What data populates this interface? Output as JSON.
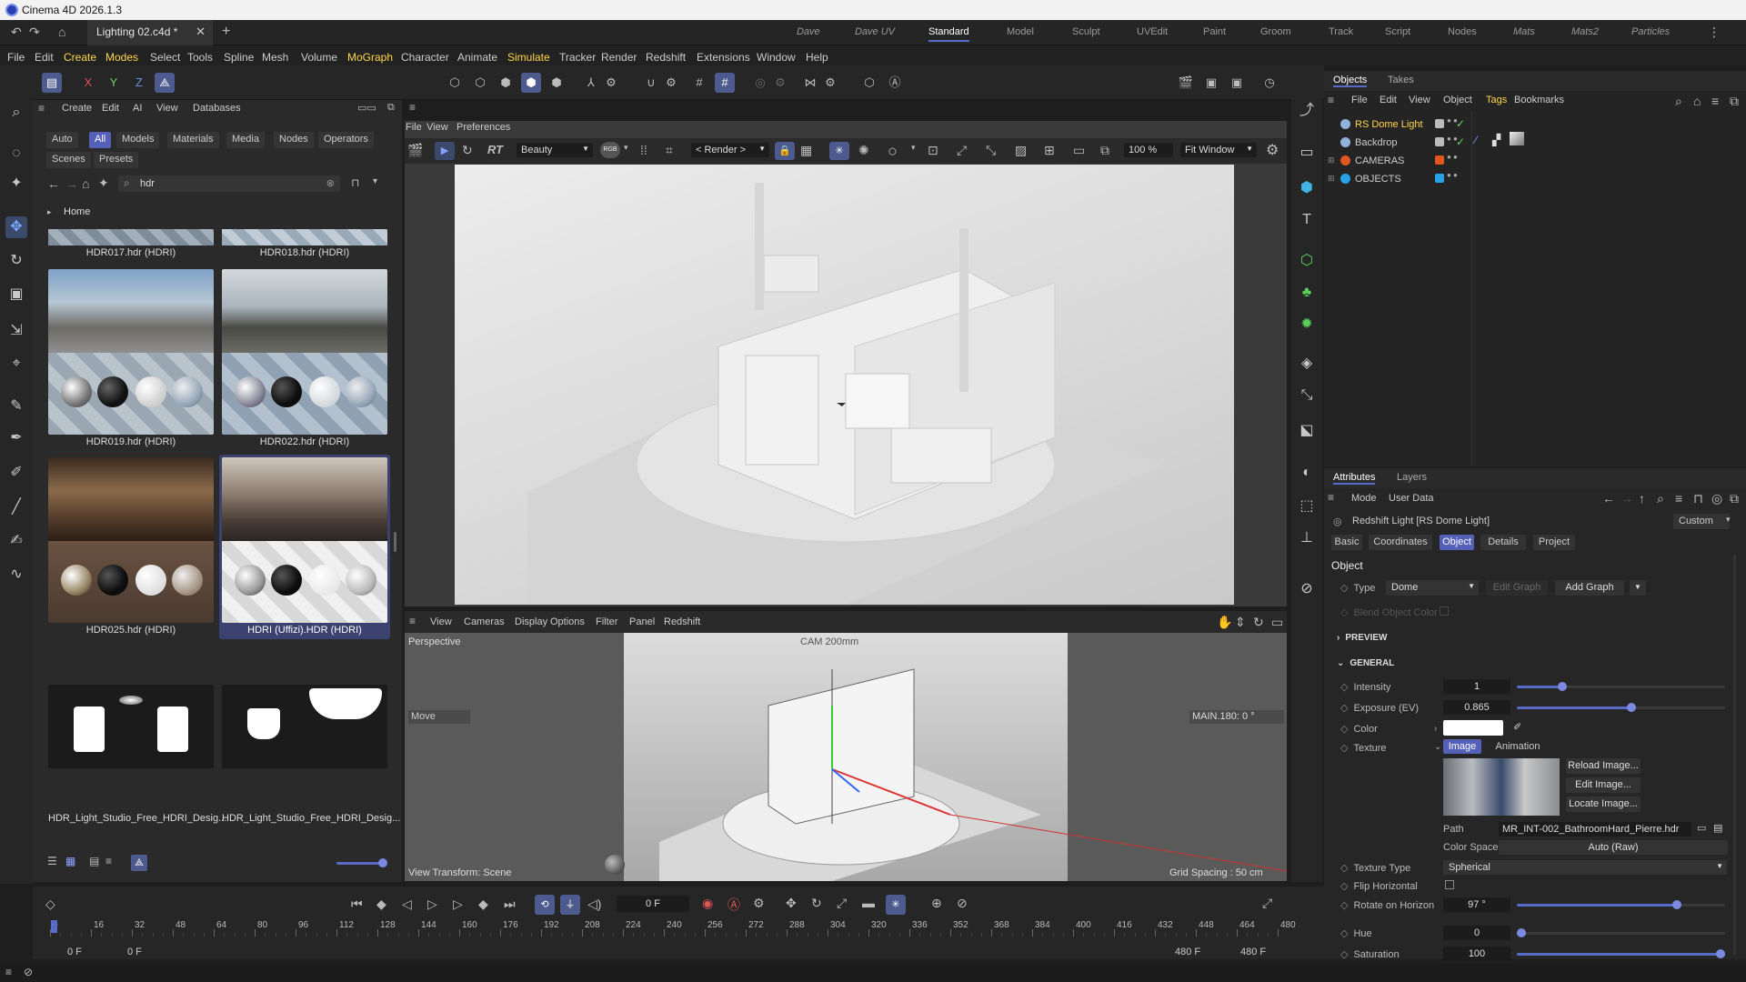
{
  "window": {
    "title": "Cinema 4D 2026.1.3"
  },
  "tabs": {
    "document": "Lighting 02.c4d *"
  },
  "layouts": [
    "Dave",
    "Dave UV",
    "Standard",
    "Model",
    "Sculpt",
    "UVEdit",
    "Paint",
    "Groom",
    "Track",
    "Script",
    "Nodes",
    "Mats",
    "Mats2",
    "Particles"
  ],
  "menu": [
    "File",
    "Edit",
    "Create",
    "Modes",
    "Select",
    "Tools",
    "Spline",
    "Mesh",
    "Volume",
    "MoGraph",
    "Character",
    "Animate",
    "Simulate",
    "Tracker",
    "Render",
    "Redshift",
    "Extensions",
    "Window",
    "Help"
  ],
  "asset_browser": {
    "menu": [
      "Create",
      "Edit",
      "AI",
      "View",
      "Databases"
    ],
    "filters": [
      "Auto",
      "All",
      "Models",
      "Materials",
      "Media",
      "Nodes",
      "Operators"
    ],
    "filters2": [
      "Scenes",
      "Presets"
    ],
    "search_value": "hdr",
    "breadcrumb": "Home",
    "items": [
      {
        "label": "HDR017.hdr (HDRI)"
      },
      {
        "label": "HDR018.hdr (HDRI)"
      },
      {
        "label": "HDR019.hdr (HDRI)"
      },
      {
        "label": "HDR022.hdr (HDRI)"
      },
      {
        "label": "HDR025.hdr (HDRI)"
      },
      {
        "label": "HDRI (Uffizi).HDR (HDRI)"
      },
      {
        "label": "HDR_Light_Studio_Free_HDRI_Desig..."
      },
      {
        "label": "HDR_Light_Studio_Free_HDRI_Desig..."
      }
    ]
  },
  "render_view": {
    "menu": [
      "File",
      "View",
      "Preferences"
    ],
    "pass": "Beauty",
    "render_dropdown": "< Render >",
    "zoom": "100 %",
    "fit": "Fit Window"
  },
  "viewport": {
    "menu": [
      "View",
      "Cameras",
      "Display",
      "Options",
      "Filter",
      "Panel",
      "Redshift"
    ],
    "name": "Perspective",
    "camera": "CAM 200mm",
    "move_label": "Move",
    "main_label": "MAIN.180:  0 °",
    "view_transform": "View Transform: Scene",
    "grid_spacing": "Grid Spacing : 50 cm"
  },
  "timeline": {
    "current_frame": "0 F",
    "ticks": [
      "0",
      "16",
      "32",
      "48",
      "64",
      "80",
      "96",
      "112",
      "128",
      "144",
      "160",
      "176",
      "192",
      "208",
      "224",
      "240",
      "256",
      "272",
      "288",
      "304",
      "320",
      "336",
      "352",
      "368",
      "384",
      "400",
      "416",
      "432",
      "448",
      "464",
      "480"
    ],
    "start_a": "0 F",
    "start_b": "0 F",
    "end_a": "480 F",
    "end_b": "480 F"
  },
  "objects_panel": {
    "tabs": [
      "Objects",
      "Takes"
    ],
    "menu": [
      "File",
      "Edit",
      "View",
      "Object",
      "Tags",
      "Bookmarks"
    ],
    "items": [
      {
        "name": "RS Dome Light",
        "color": "#ffd54a"
      },
      {
        "name": "Backdrop",
        "color": "#cccccc"
      },
      {
        "name": "CAMERAS",
        "color": "#cccccc",
        "dot": "#e0561f"
      },
      {
        "name": "OBJECTS",
        "color": "#cccccc",
        "dot": "#27a3e6"
      }
    ]
  },
  "attributes": {
    "tabs": [
      "Attributes",
      "Layers"
    ],
    "menu": [
      "Mode",
      "User Data"
    ],
    "preset": "Custom",
    "title": "Redshift Light [RS Dome Light]",
    "subtabs": [
      "Basic",
      "Coordinates",
      "Object",
      "Details",
      "Project"
    ],
    "section": "Object",
    "type_label": "Type",
    "type_value": "Dome",
    "edit_graph": "Edit Graph",
    "add_graph": "Add Graph",
    "blend_object_color": "Blend Object Color",
    "preview": "PREVIEW",
    "general": "GENERAL",
    "intensity_label": "Intensity",
    "intensity": "1",
    "intensity_level": 0.22,
    "exposure_label": "Exposure (EV)",
    "exposure": "0.865",
    "exposure_level": 0.55,
    "color_label": "Color",
    "texture_label": "Texture",
    "texture_tabs": [
      "Image",
      "Animation"
    ],
    "texture_buttons": [
      "Reload Image...",
      "Edit Image...",
      "Locate Image..."
    ],
    "path_label": "Path",
    "path": "MR_INT-002_BathroomHard_Pierre.hdr",
    "color_space_label": "Color Space",
    "color_space": "Auto (Raw)",
    "texture_type_label": "Texture Type",
    "texture_type": "Spherical",
    "flip_horizontal": "Flip Horizontal",
    "rotate_label": "Rotate on Horizon",
    "rotate": "97 °",
    "rotate_level": 0.77,
    "hue_label": "Hue",
    "hue": "0",
    "hue_level": 0.01,
    "saturation_label": "Saturation",
    "saturation": "100",
    "saturation_level": 1.0
  },
  "colors": {
    "accent": "#5560b8",
    "highlight": "#ffd54a"
  }
}
